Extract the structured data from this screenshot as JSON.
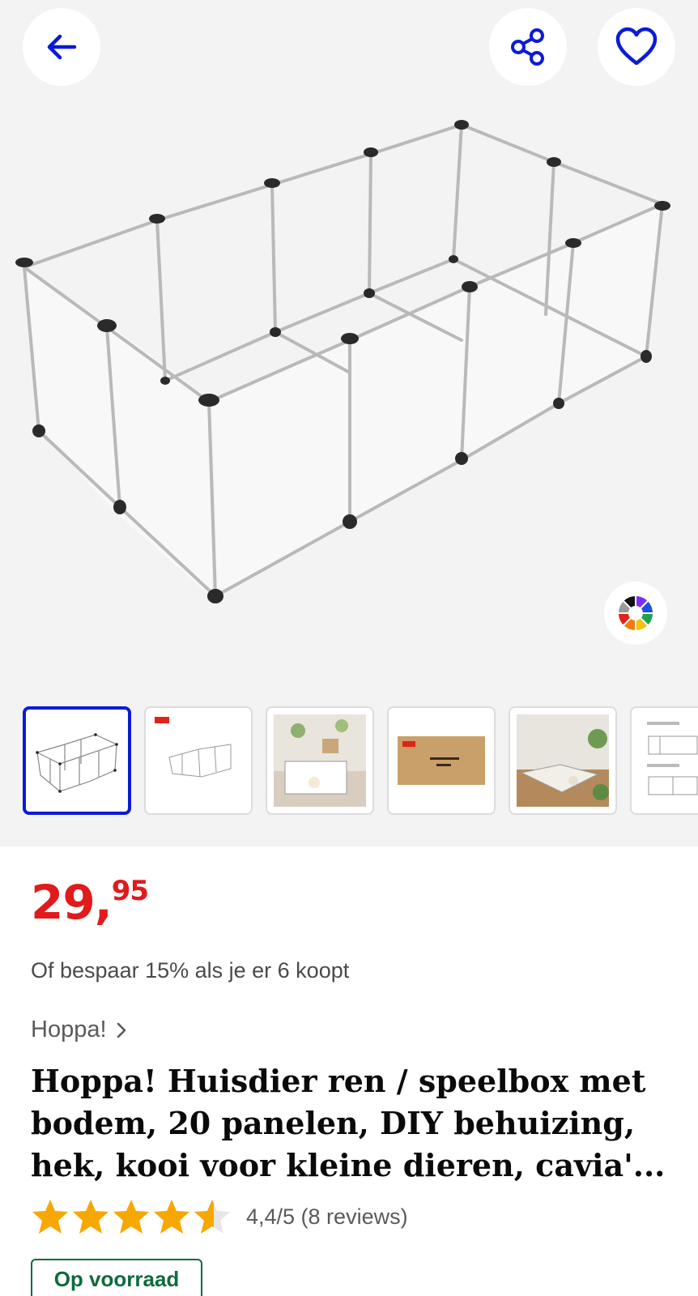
{
  "header": {
    "back_icon": "arrow-left-icon",
    "share_icon": "share-icon",
    "favorite_icon": "heart-icon",
    "accent_color": "#0b1bd6"
  },
  "gallery": {
    "main_image": "pet playpen with transparent panels",
    "color_picker_icon": "color-wheel-icon",
    "thumbnails": [
      {
        "alt": "playpen-overview",
        "active": true
      },
      {
        "alt": "playpen-small-view",
        "active": false
      },
      {
        "alt": "playpen-in-room",
        "active": false
      },
      {
        "alt": "product-box",
        "active": false
      },
      {
        "alt": "playpen-living-room",
        "active": false
      },
      {
        "alt": "setup-diagram",
        "active": false
      }
    ]
  },
  "product": {
    "price_main": "29,",
    "price_cents": "95",
    "price_color": "#e01b1b",
    "deal_text": "Of bespaar 15% als je er 6 koopt",
    "brand": "Hoppa!",
    "title": "Hoppa! Huisdier ren / speelbox met bodem, 20 panelen, DIY behuizing, hek, kooi voor kleine dieren, cavia'...",
    "rating_value": 4.4,
    "rating_text": "4,4/5 (8 reviews)",
    "stock_label": "Op voorraad",
    "stock_color": "#0e6b3c"
  }
}
